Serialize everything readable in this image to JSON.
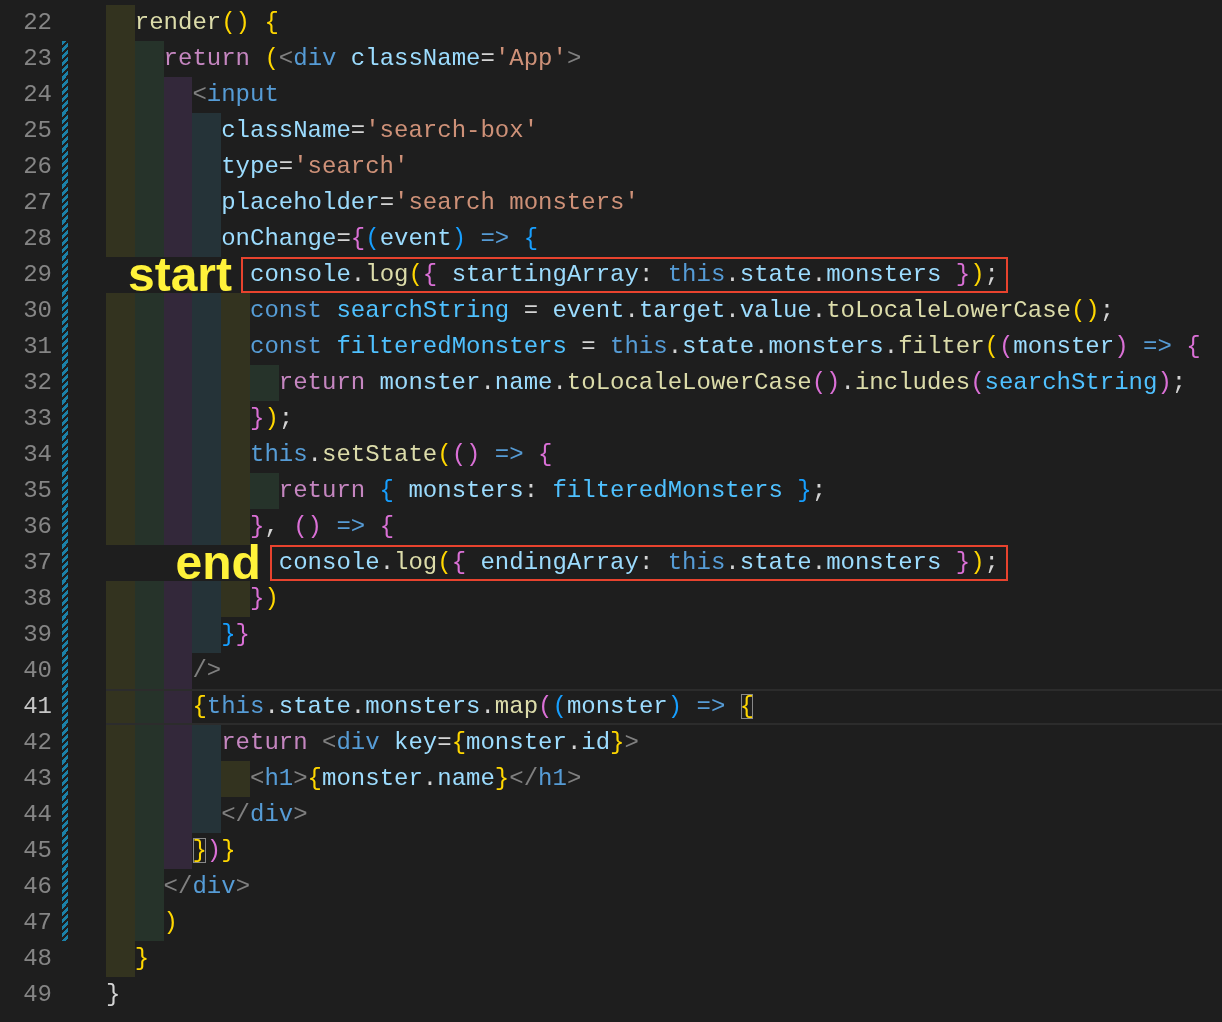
{
  "editor": {
    "lines": [
      {
        "number": "22",
        "modified": false,
        "current": false,
        "tokens": [
          {
            "text": "  render",
            "kind": "f"
          },
          {
            "text": "() ",
            "kind": "b1"
          },
          {
            "text": "{",
            "kind": "b1"
          }
        ]
      },
      {
        "number": "23",
        "modified": true,
        "current": false,
        "tokens": [
          {
            "text": "    return ",
            "kind": "c"
          },
          {
            "text": "(",
            "kind": "b1"
          },
          {
            "text": "<",
            "kind": "g"
          },
          {
            "text": "div ",
            "kind": "k"
          },
          {
            "text": "className",
            "kind": "v"
          },
          {
            "text": "=",
            "kind": "p"
          },
          {
            "text": "'App'",
            "kind": "s"
          },
          {
            "text": ">",
            "kind": "g"
          }
        ]
      },
      {
        "number": "24",
        "modified": true,
        "current": false,
        "tokens": [
          {
            "text": "      <",
            "kind": "g"
          },
          {
            "text": "input",
            "kind": "k"
          }
        ]
      },
      {
        "number": "25",
        "modified": true,
        "current": false,
        "tokens": [
          {
            "text": "        className",
            "kind": "v"
          },
          {
            "text": "=",
            "kind": "p"
          },
          {
            "text": "'search-box'",
            "kind": "s"
          }
        ]
      },
      {
        "number": "26",
        "modified": true,
        "current": false,
        "tokens": [
          {
            "text": "        type",
            "kind": "v"
          },
          {
            "text": "=",
            "kind": "p"
          },
          {
            "text": "'search'",
            "kind": "s"
          }
        ]
      },
      {
        "number": "27",
        "modified": true,
        "current": false,
        "tokens": [
          {
            "text": "        placeholder",
            "kind": "v"
          },
          {
            "text": "=",
            "kind": "p"
          },
          {
            "text": "'search monsters'",
            "kind": "s"
          }
        ]
      },
      {
        "number": "28",
        "modified": true,
        "current": false,
        "tokens": [
          {
            "text": "        onChange",
            "kind": "v"
          },
          {
            "text": "=",
            "kind": "p"
          },
          {
            "text": "{",
            "kind": "b2"
          },
          {
            "text": "(",
            "kind": "b3"
          },
          {
            "text": "event",
            "kind": "v"
          },
          {
            "text": ") ",
            "kind": "b3"
          },
          {
            "text": "=> ",
            "kind": "k"
          },
          {
            "text": "{",
            "kind": "b3"
          }
        ]
      },
      {
        "number": "29",
        "modified": true,
        "current": false,
        "annotation": "start",
        "boxed": true,
        "tokens": [
          {
            "text": "          console",
            "kind": "v"
          },
          {
            "text": ".",
            "kind": "p"
          },
          {
            "text": "log",
            "kind": "f"
          },
          {
            "text": "(",
            "kind": "b1"
          },
          {
            "text": "{ ",
            "kind": "b2"
          },
          {
            "text": "startingArray",
            "kind": "v"
          },
          {
            "text": ": ",
            "kind": "p"
          },
          {
            "text": "this",
            "kind": "k"
          },
          {
            "text": ".",
            "kind": "p"
          },
          {
            "text": "state",
            "kind": "v"
          },
          {
            "text": ".",
            "kind": "p"
          },
          {
            "text": "monsters ",
            "kind": "v"
          },
          {
            "text": "}",
            "kind": "b2"
          },
          {
            "text": ")",
            "kind": "b1"
          },
          {
            "text": ";",
            "kind": "p"
          }
        ]
      },
      {
        "number": "30",
        "modified": true,
        "current": false,
        "tokens": [
          {
            "text": "          const ",
            "kind": "k"
          },
          {
            "text": "searchString",
            "kind": "n"
          },
          {
            "text": " = ",
            "kind": "p"
          },
          {
            "text": "event",
            "kind": "v"
          },
          {
            "text": ".",
            "kind": "p"
          },
          {
            "text": "target",
            "kind": "v"
          },
          {
            "text": ".",
            "kind": "p"
          },
          {
            "text": "value",
            "kind": "v"
          },
          {
            "text": ".",
            "kind": "p"
          },
          {
            "text": "toLocaleLowerCase",
            "kind": "f"
          },
          {
            "text": "()",
            "kind": "b1"
          },
          {
            "text": ";",
            "kind": "p"
          }
        ]
      },
      {
        "number": "31",
        "modified": true,
        "current": false,
        "tokens": [
          {
            "text": "          const ",
            "kind": "k"
          },
          {
            "text": "filteredMonsters",
            "kind": "n"
          },
          {
            "text": " = ",
            "kind": "p"
          },
          {
            "text": "this",
            "kind": "k"
          },
          {
            "text": ".",
            "kind": "p"
          },
          {
            "text": "state",
            "kind": "v"
          },
          {
            "text": ".",
            "kind": "p"
          },
          {
            "text": "monsters",
            "kind": "v"
          },
          {
            "text": ".",
            "kind": "p"
          },
          {
            "text": "filter",
            "kind": "f"
          },
          {
            "text": "(",
            "kind": "b1"
          },
          {
            "text": "(",
            "kind": "b2"
          },
          {
            "text": "monster",
            "kind": "v"
          },
          {
            "text": ") ",
            "kind": "b2"
          },
          {
            "text": "=> ",
            "kind": "k"
          },
          {
            "text": "{",
            "kind": "b2"
          }
        ]
      },
      {
        "number": "32",
        "modified": true,
        "current": false,
        "tokens": [
          {
            "text": "            return ",
            "kind": "c"
          },
          {
            "text": "monster",
            "kind": "v"
          },
          {
            "text": ".",
            "kind": "p"
          },
          {
            "text": "name",
            "kind": "v"
          },
          {
            "text": ".",
            "kind": "p"
          },
          {
            "text": "toLocaleLowerCase",
            "kind": "f"
          },
          {
            "text": "()",
            "kind": "b2"
          },
          {
            "text": ".",
            "kind": "p"
          },
          {
            "text": "includes",
            "kind": "f"
          },
          {
            "text": "(",
            "kind": "b2"
          },
          {
            "text": "searchString",
            "kind": "n"
          },
          {
            "text": ")",
            "kind": "b2"
          },
          {
            "text": ";",
            "kind": "p"
          }
        ]
      },
      {
        "number": "33",
        "modified": true,
        "current": false,
        "tokens": [
          {
            "text": "          }",
            "kind": "b2"
          },
          {
            "text": ")",
            "kind": "b1"
          },
          {
            "text": ";",
            "kind": "p"
          }
        ]
      },
      {
        "number": "34",
        "modified": true,
        "current": false,
        "tokens": [
          {
            "text": "          this",
            "kind": "k"
          },
          {
            "text": ".",
            "kind": "p"
          },
          {
            "text": "setState",
            "kind": "f"
          },
          {
            "text": "(",
            "kind": "b1"
          },
          {
            "text": "() ",
            "kind": "b2"
          },
          {
            "text": "=> ",
            "kind": "k"
          },
          {
            "text": "{",
            "kind": "b2"
          }
        ]
      },
      {
        "number": "35",
        "modified": true,
        "current": false,
        "tokens": [
          {
            "text": "            return ",
            "kind": "c"
          },
          {
            "text": "{ ",
            "kind": "b3"
          },
          {
            "text": "monsters",
            "kind": "v"
          },
          {
            "text": ": ",
            "kind": "p"
          },
          {
            "text": "filteredMonsters ",
            "kind": "n"
          },
          {
            "text": "}",
            "kind": "b3"
          },
          {
            "text": ";",
            "kind": "p"
          }
        ]
      },
      {
        "number": "36",
        "modified": true,
        "current": false,
        "tokens": [
          {
            "text": "          }",
            "kind": "b2"
          },
          {
            "text": ", ",
            "kind": "p"
          },
          {
            "text": "() ",
            "kind": "b2"
          },
          {
            "text": "=> ",
            "kind": "k"
          },
          {
            "text": "{",
            "kind": "b2"
          }
        ]
      },
      {
        "number": "37",
        "modified": true,
        "current": false,
        "annotation": "end",
        "boxed": true,
        "tokens": [
          {
            "text": "            console",
            "kind": "v"
          },
          {
            "text": ".",
            "kind": "p"
          },
          {
            "text": "log",
            "kind": "f"
          },
          {
            "text": "(",
            "kind": "b1"
          },
          {
            "text": "{ ",
            "kind": "b2"
          },
          {
            "text": "endingArray",
            "kind": "v"
          },
          {
            "text": ": ",
            "kind": "p"
          },
          {
            "text": "this",
            "kind": "k"
          },
          {
            "text": ".",
            "kind": "p"
          },
          {
            "text": "state",
            "kind": "v"
          },
          {
            "text": ".",
            "kind": "p"
          },
          {
            "text": "monsters ",
            "kind": "v"
          },
          {
            "text": "}",
            "kind": "b2"
          },
          {
            "text": ")",
            "kind": "b1"
          },
          {
            "text": ";",
            "kind": "p"
          }
        ]
      },
      {
        "number": "38",
        "modified": true,
        "current": false,
        "tokens": [
          {
            "text": "          }",
            "kind": "b2"
          },
          {
            "text": ")",
            "kind": "b1"
          }
        ]
      },
      {
        "number": "39",
        "modified": true,
        "current": false,
        "tokens": [
          {
            "text": "        }",
            "kind": "b3"
          },
          {
            "text": "}",
            "kind": "b2"
          }
        ]
      },
      {
        "number": "40",
        "modified": true,
        "current": false,
        "tokens": [
          {
            "text": "      />",
            "kind": "g"
          }
        ]
      },
      {
        "number": "41",
        "modified": true,
        "current": true,
        "tokens": [
          {
            "text": "      {",
            "kind": "b1"
          },
          {
            "text": "this",
            "kind": "k"
          },
          {
            "text": ".",
            "kind": "p"
          },
          {
            "text": "state",
            "kind": "v"
          },
          {
            "text": ".",
            "kind": "p"
          },
          {
            "text": "monsters",
            "kind": "v"
          },
          {
            "text": ".",
            "kind": "p"
          },
          {
            "text": "map",
            "kind": "f"
          },
          {
            "text": "(",
            "kind": "b2"
          },
          {
            "text": "(",
            "kind": "b3"
          },
          {
            "text": "monster",
            "kind": "v"
          },
          {
            "text": ") ",
            "kind": "b3"
          },
          {
            "text": "=> ",
            "kind": "k"
          },
          {
            "text": "{",
            "kind": "match"
          }
        ]
      },
      {
        "number": "42",
        "modified": true,
        "current": false,
        "tokens": [
          {
            "text": "        return ",
            "kind": "c"
          },
          {
            "text": "<",
            "kind": "g"
          },
          {
            "text": "div ",
            "kind": "k"
          },
          {
            "text": "key",
            "kind": "v"
          },
          {
            "text": "=",
            "kind": "p"
          },
          {
            "text": "{",
            "kind": "b1"
          },
          {
            "text": "monster",
            "kind": "v"
          },
          {
            "text": ".",
            "kind": "p"
          },
          {
            "text": "id",
            "kind": "v"
          },
          {
            "text": "}",
            "kind": "b1"
          },
          {
            "text": ">",
            "kind": "g"
          }
        ]
      },
      {
        "number": "43",
        "modified": true,
        "current": false,
        "tokens": [
          {
            "text": "          <",
            "kind": "g"
          },
          {
            "text": "h1",
            "kind": "k"
          },
          {
            "text": ">",
            "kind": "g"
          },
          {
            "text": "{",
            "kind": "b1"
          },
          {
            "text": "monster",
            "kind": "v"
          },
          {
            "text": ".",
            "kind": "p"
          },
          {
            "text": "name",
            "kind": "v"
          },
          {
            "text": "}",
            "kind": "b1"
          },
          {
            "text": "</",
            "kind": "g"
          },
          {
            "text": "h1",
            "kind": "k"
          },
          {
            "text": ">",
            "kind": "g"
          }
        ]
      },
      {
        "number": "44",
        "modified": true,
        "current": false,
        "tokens": [
          {
            "text": "        </",
            "kind": "g"
          },
          {
            "text": "div",
            "kind": "k"
          },
          {
            "text": ">",
            "kind": "g"
          }
        ]
      },
      {
        "number": "45",
        "modified": true,
        "current": false,
        "tokens": [
          {
            "text": "      }",
            "kind": "match"
          },
          {
            "text": ")",
            "kind": "b2"
          },
          {
            "text": "}",
            "kind": "b1"
          }
        ]
      },
      {
        "number": "46",
        "modified": true,
        "current": false,
        "tokens": [
          {
            "text": "    </",
            "kind": "g"
          },
          {
            "text": "div",
            "kind": "k"
          },
          {
            "text": ">",
            "kind": "g"
          }
        ]
      },
      {
        "number": "47",
        "modified": true,
        "current": false,
        "tokens": [
          {
            "text": "    )",
            "kind": "b1"
          }
        ]
      },
      {
        "number": "48",
        "modified": false,
        "current": false,
        "tokens": [
          {
            "text": "  }",
            "kind": "b1"
          }
        ]
      },
      {
        "number": "49",
        "modified": false,
        "current": false,
        "tokens": [
          {
            "text": "}",
            "kind": "p"
          }
        ]
      }
    ]
  }
}
